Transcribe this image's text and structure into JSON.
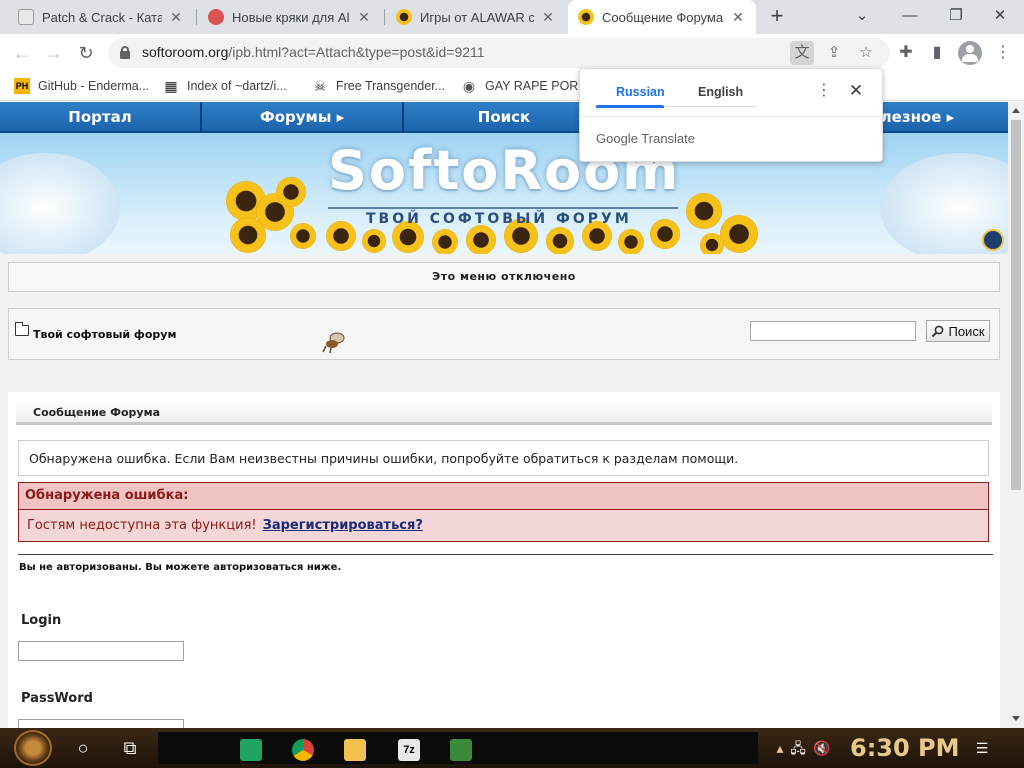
{
  "browser": {
    "tabs": [
      {
        "title": "Patch & Crack - Катал",
        "active": false
      },
      {
        "title": "Новые кряки для Alav",
        "active": false
      },
      {
        "title": "Игры от ALAWAR с к",
        "active": false
      },
      {
        "title": "Сообщение Форума с",
        "active": true
      }
    ],
    "tab_close": "✕",
    "new_tab": "+",
    "window_controls": {
      "minimize": "—",
      "maximize": "❐",
      "close": "✕",
      "tab_search": "⌄"
    },
    "url_host": "softoroom.org",
    "url_path": "/ipb.html?act=Attach&type=post&id=9211",
    "icons": {
      "back": "←",
      "forward": "→",
      "reload": "↻",
      "translate": "文",
      "share": "⇪",
      "bookmark_star": "☆",
      "extensions": "✚",
      "side_panel": "▮"
    },
    "bookmarks": [
      {
        "label": "GitHub - Enderma...",
        "icon": "PH",
        "color": "#f7b500"
      },
      {
        "label": "Index of ~dartz/i...",
        "icon": "▦",
        "color": "#222222"
      },
      {
        "label": "Free Transgender...",
        "icon": "☠",
        "color": "#333333"
      },
      {
        "label": "GAY RAPE PORN",
        "icon": "◉",
        "color": "#555555"
      }
    ]
  },
  "translate_popup": {
    "lang_source": "Russian",
    "lang_target": "English",
    "more": "⋮",
    "close": "✕",
    "brand": "Google Translate",
    "accent": "#1a73e8"
  },
  "site": {
    "nav": [
      "Портал",
      "Форумы ▸",
      "Поиск",
      "Полезное ▸"
    ],
    "logo_text": "SoftoRoom",
    "slogan": "ТВОЙ СОФТОВЫЙ ФОРУМ",
    "menu_disabled": "Это меню отключено",
    "breadcrumb": "Твой софтовый форум",
    "search_button": "Поиск",
    "search_value": "",
    "section_title": "Сообщение Форума",
    "info_text": "Обнаружена ошибка. Если Вам неизвестны причины ошибки, попробуйте обратиться к разделам помощи.",
    "error_title": "Обнаружена ошибка:",
    "error_text": "Гостям недоступна эта функция!",
    "register_link": "Зарегистрироваться?",
    "login_note": "Вы не авторизованы. Вы можете авторизоваться ниже.",
    "login_label": "Login",
    "password_label": "PassWord",
    "login_value": "",
    "password_value": "",
    "colors": {
      "nav_blue": "#1d64ad",
      "error_red": "#8b1a1a",
      "error_bg": "#f3d6d6",
      "link_blue": "#1a2a7a"
    }
  },
  "taskbar": {
    "time": "6:30 PM",
    "icons": {
      "search": "○",
      "task_view": "⧉",
      "network": "🖧",
      "volume": "🔇",
      "notifications": "☰"
    }
  }
}
